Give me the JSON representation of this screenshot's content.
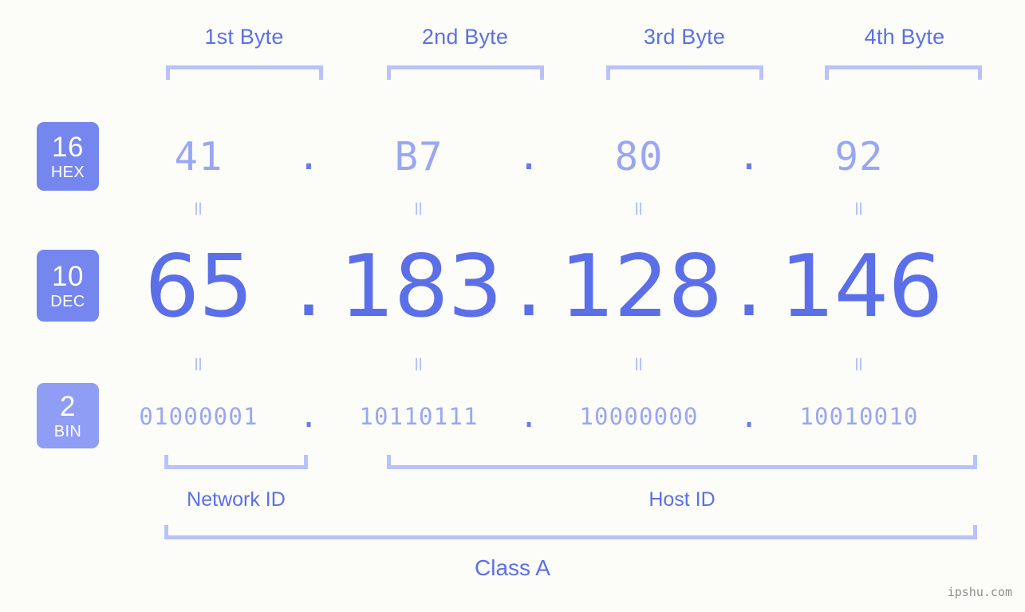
{
  "background_color": "#fcfdf8",
  "accent_colors": {
    "badge_strong": "#7586ee",
    "badge_light": "#8f9df4",
    "text_strong": "#5b6fe8",
    "text_light": "#99a6f5",
    "bracket": "#b9c2fb",
    "watermark": "#8d8d8d"
  },
  "byte_headers": [
    {
      "label": "1st Byte"
    },
    {
      "label": "2nd Byte"
    },
    {
      "label": "3rd Byte"
    },
    {
      "label": "4th Byte"
    }
  ],
  "bases": [
    {
      "number": "16",
      "abbr": "HEX"
    },
    {
      "number": "10",
      "abbr": "DEC"
    },
    {
      "number": "2",
      "abbr": "BIN"
    }
  ],
  "rows": {
    "hex": {
      "values": [
        "41",
        "B7",
        "80",
        "92"
      ],
      "separator": "."
    },
    "dec": {
      "values": [
        "65",
        "183",
        "128",
        "146"
      ],
      "separator": "."
    },
    "bin": {
      "values": [
        "01000001",
        "10110111",
        "10000000",
        "10010010"
      ],
      "separator": "."
    }
  },
  "equals": {
    "symbol": "=",
    "hex_to_dec": [
      "=",
      "=",
      "=",
      "="
    ],
    "dec_to_bin": [
      "=",
      "=",
      "=",
      "="
    ]
  },
  "sections": [
    {
      "label": "Network ID"
    },
    {
      "label": "Host ID"
    }
  ],
  "class": {
    "label": "Class A"
  },
  "watermark": {
    "text": "ipshu.com"
  }
}
